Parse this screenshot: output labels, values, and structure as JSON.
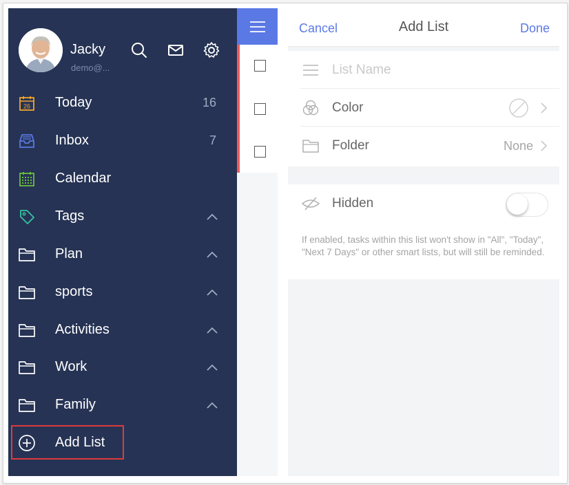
{
  "user": {
    "name": "Jacky",
    "email": "demo@..."
  },
  "header_icons": [
    "search-icon",
    "mail-icon",
    "settings-gear-icon"
  ],
  "nav": {
    "today": {
      "label": "Today",
      "count": "16",
      "date_badge": "26"
    },
    "inbox": {
      "label": "Inbox",
      "count": "7"
    },
    "calendar": {
      "label": "Calendar"
    },
    "tags": {
      "label": "Tags"
    },
    "folders": [
      {
        "label": "Plan"
      },
      {
        "label": "sports"
      },
      {
        "label": "Activities"
      },
      {
        "label": "Work"
      },
      {
        "label": "Family"
      }
    ],
    "add_list": {
      "label": "Add List"
    }
  },
  "panel": {
    "cancel_label": "Cancel",
    "title": "Add List",
    "done_label": "Done",
    "list_name_placeholder": "List Name",
    "color_label": "Color",
    "folder_label": "Folder",
    "folder_value": "None",
    "hidden_label": "Hidden",
    "hidden_enabled": false,
    "hidden_hint": "If enabled, tasks within this list won't show in \"All\", \"Today\", \"Next 7 Days\" or other smart lists, but will still be reminded."
  },
  "colors": {
    "sidebar_bg": "#263354",
    "accent": "#5b79e5",
    "task_strip_border": "#ec5d5d",
    "highlight_box": "#e03b3b"
  }
}
